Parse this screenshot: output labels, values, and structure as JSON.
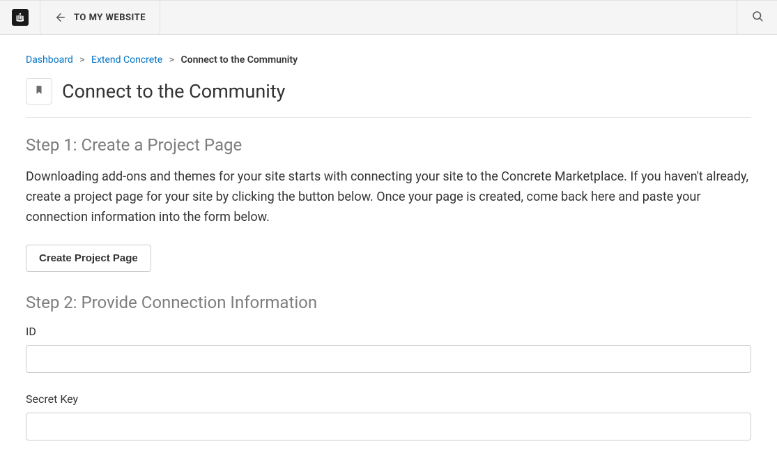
{
  "header": {
    "back_link": "TO MY WEBSITE"
  },
  "breadcrumb": {
    "items": [
      {
        "label": "Dashboard",
        "link": true
      },
      {
        "label": "Extend Concrete",
        "link": true
      },
      {
        "label": "Connect to the Community",
        "link": false
      }
    ]
  },
  "page": {
    "title": "Connect to the Community"
  },
  "step1": {
    "heading": "Step 1: Create a Project Page",
    "body": "Downloading add-ons and themes for your site starts with connecting your site to the Concrete Marketplace. If you haven't already, create a project page for your site by clicking the button below. Once your page is created, come back here and paste your connection information into the form below.",
    "button": "Create Project Page"
  },
  "step2": {
    "heading": "Step 2: Provide Connection Information",
    "fields": {
      "id_label": "ID",
      "id_value": "",
      "secret_label": "Secret Key",
      "secret_value": ""
    }
  }
}
